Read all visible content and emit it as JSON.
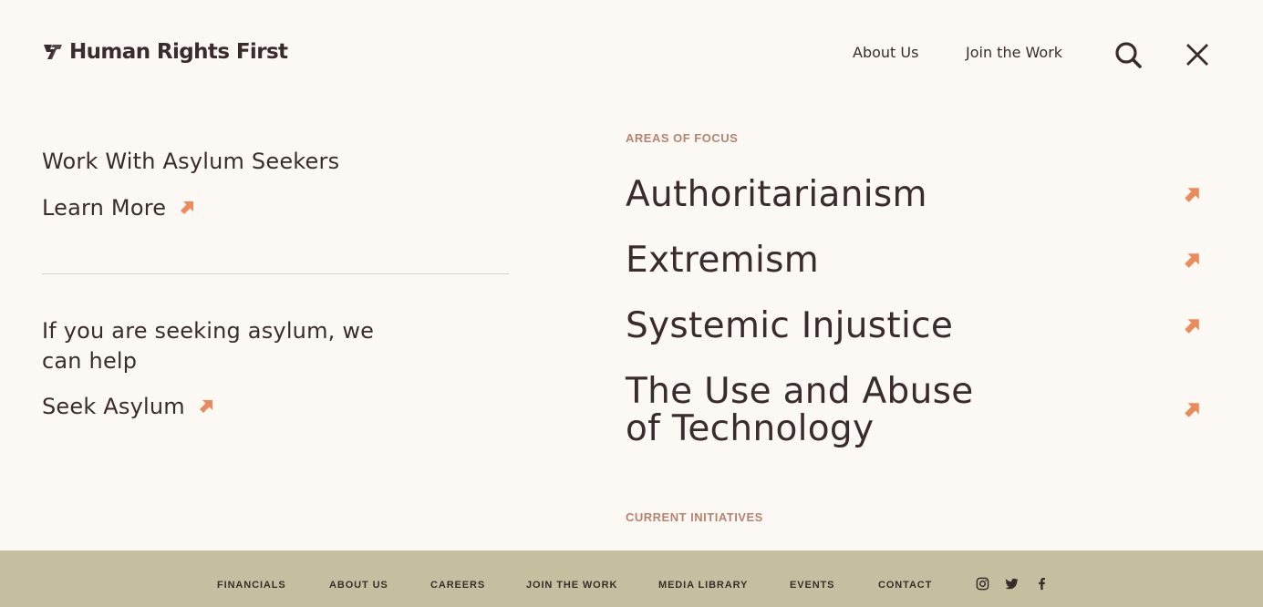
{
  "header": {
    "logo_text": "Human Rights First",
    "nav": [
      "About Us",
      "Join the Work"
    ],
    "search_icon": "search-icon",
    "close_icon": "close-icon"
  },
  "left": {
    "block1_title": "Work With Asylum Seekers",
    "block1_link": "Learn More",
    "block2_title": "If you are seeking asylum, we can help",
    "block2_link": "Seek Asylum"
  },
  "areas": {
    "label": "AREAS OF FOCUS",
    "items": [
      "Authoritarianism",
      "Extremism",
      "Systemic Injustice",
      "The Use and Abuse of Technology"
    ]
  },
  "initiatives": {
    "label": "CURRENT INITIATIVES"
  },
  "footer": {
    "links": [
      "FINANCIALS",
      "ABOUT US",
      "CAREERS",
      "JOIN THE WORK",
      "MEDIA LIBRARY",
      "EVENTS",
      "CONTACT"
    ],
    "social": [
      "instagram-icon",
      "twitter-icon",
      "facebook-icon"
    ]
  },
  "colors": {
    "background": "#fcf9f5",
    "text": "#3a2c2c",
    "accent_arrow": "#ec8a5c",
    "section_label": "#b6836f",
    "footer_bg": "#c5bf9f"
  }
}
